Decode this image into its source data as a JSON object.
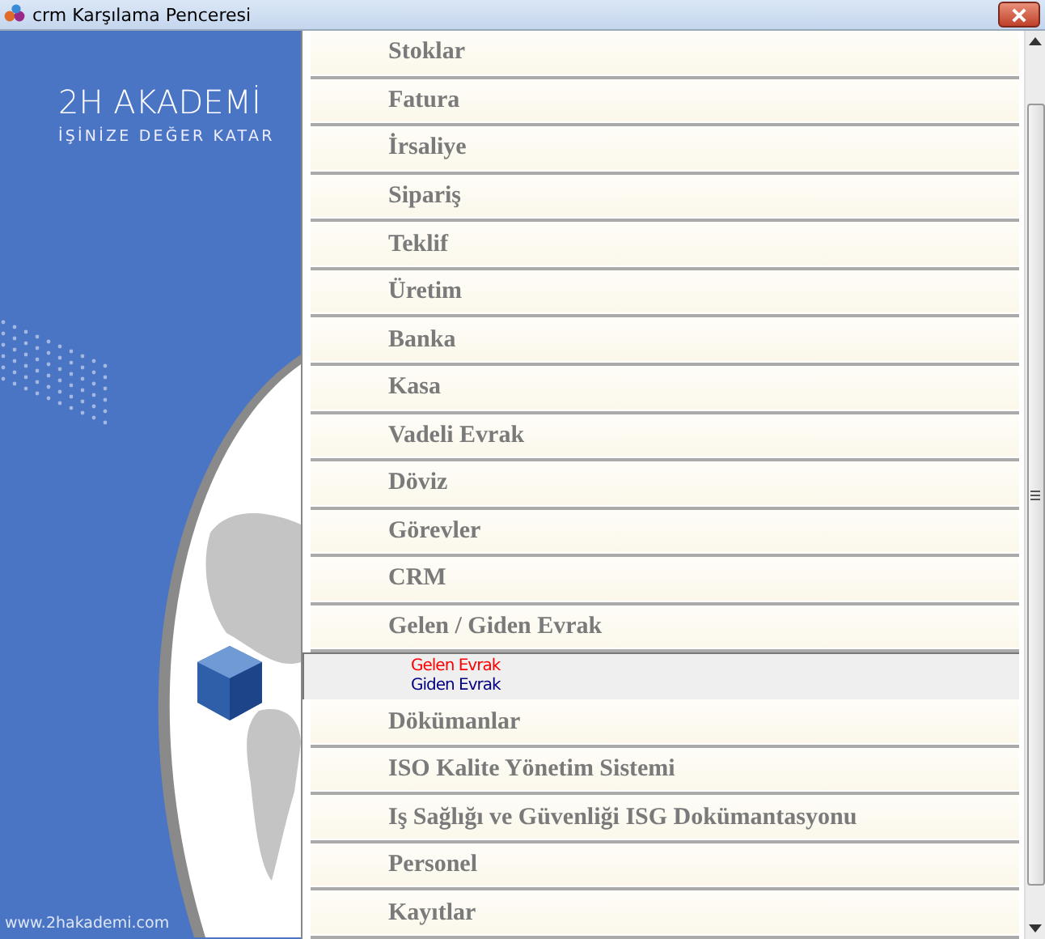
{
  "window": {
    "title": "crm Karşılama Penceresi"
  },
  "brand": {
    "logo": "2H AKADEMİ",
    "tagline": "İŞİNİZE DEĞER KATAR",
    "website": "www.2hakademi.com"
  },
  "menu": [
    {
      "label": "Stoklar"
    },
    {
      "label": "Fatura"
    },
    {
      "label": "İrsaliye"
    },
    {
      "label": "Sipariş"
    },
    {
      "label": "Teklif"
    },
    {
      "label": "Üretim"
    },
    {
      "label": "Banka"
    },
    {
      "label": "Kasa"
    },
    {
      "label": "Vadeli Evrak"
    },
    {
      "label": "Döviz"
    },
    {
      "label": "Görevler"
    },
    {
      "label": "CRM"
    },
    {
      "label": "Gelen / Giden Evrak",
      "expanded": true,
      "children": [
        {
          "label": "Gelen Evrak",
          "color": "#ff0000"
        },
        {
          "label": "Giden Evrak",
          "color": "#000080"
        }
      ]
    },
    {
      "label": "Dökümanlar"
    },
    {
      "label": "ISO Kalite Yönetim Sistemi"
    },
    {
      "label": "Iş Sağlığı ve Güvenliği ISG Dokümantasyonu"
    },
    {
      "label": "Personel"
    },
    {
      "label": "Kayıtlar"
    }
  ]
}
